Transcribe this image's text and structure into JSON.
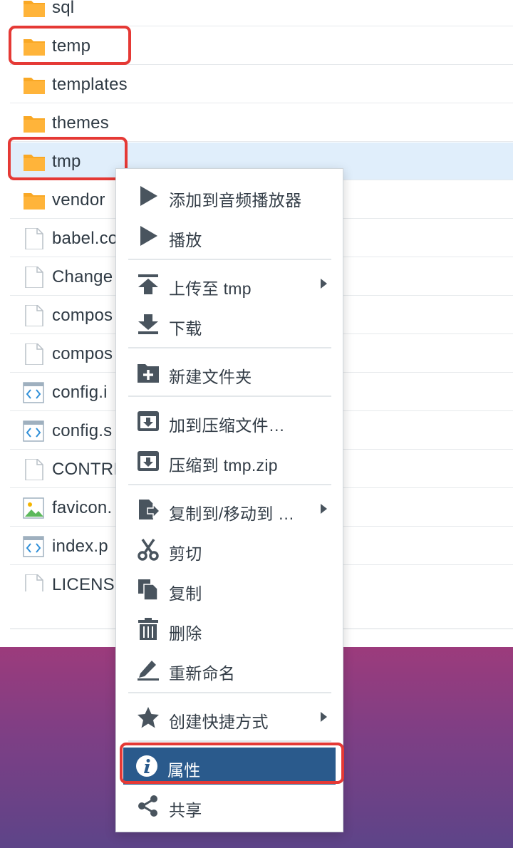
{
  "files": [
    {
      "name": "sql",
      "type": "folder"
    },
    {
      "name": "temp",
      "type": "folder"
    },
    {
      "name": "templates",
      "type": "folder"
    },
    {
      "name": "themes",
      "type": "folder"
    },
    {
      "name": "tmp",
      "type": "folder",
      "selected": true
    },
    {
      "name": "vendor",
      "type": "folder"
    },
    {
      "name": "babel.co",
      "type": "file"
    },
    {
      "name": "Change",
      "type": "file"
    },
    {
      "name": "compos",
      "type": "file"
    },
    {
      "name": "compos",
      "type": "file"
    },
    {
      "name": "config.i",
      "type": "code"
    },
    {
      "name": "config.s",
      "type": "code"
    },
    {
      "name": "CONTRI",
      "type": "file"
    },
    {
      "name": "favicon.",
      "type": "image"
    },
    {
      "name": "index.p",
      "type": "code"
    },
    {
      "name": "LICENS",
      "type": "file"
    }
  ],
  "context_menu": {
    "items": [
      {
        "label": "添加到音频播放器",
        "icon": "play-icon"
      },
      {
        "label": "播放",
        "icon": "play-icon"
      },
      {
        "label": "上传至 tmp",
        "icon": "upload-icon",
        "submenu": true
      },
      {
        "label": "下载",
        "icon": "download-icon"
      },
      {
        "label": "新建文件夹",
        "icon": "new-folder-icon"
      },
      {
        "label": "加到压缩文件…",
        "icon": "archive-icon"
      },
      {
        "label": "压缩到 tmp.zip",
        "icon": "archive-icon"
      },
      {
        "label": "复制到/移动到 …",
        "icon": "copy-move-icon",
        "submenu": true
      },
      {
        "label": "剪切",
        "icon": "scissors-icon"
      },
      {
        "label": "复制",
        "icon": "copy-icon"
      },
      {
        "label": "删除",
        "icon": "trash-icon"
      },
      {
        "label": "重新命名",
        "icon": "rename-icon"
      },
      {
        "label": "创建快捷方式",
        "icon": "star-icon",
        "submenu": true
      },
      {
        "label": "属性",
        "icon": "info-icon",
        "active": true
      },
      {
        "label": "共享",
        "icon": "share-icon"
      }
    ]
  },
  "colors": {
    "folder": "#f9a825",
    "menu_active": "#2a5a8c",
    "selected_row": "#e0eefb",
    "highlight": "#e53935"
  }
}
